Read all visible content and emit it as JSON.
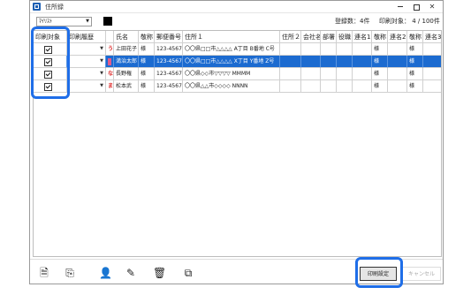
{
  "window": {
    "title": "住所録"
  },
  "header": {
    "sender_value": "ﾏｲﾘｽﾄ",
    "registered_count": "登録数：4件",
    "print_count": "印刷対象： 4 / 100件"
  },
  "grid": {
    "columns": [
      "印刷対象",
      "印刷履歴",
      "",
      "氏名",
      "敬称",
      "郵便番号",
      "住所１",
      "住所２",
      "会社名",
      "部署",
      "役職",
      "連名1",
      "敬称",
      "連名2",
      "敬称",
      "連名3"
    ],
    "rows": [
      {
        "checked": true,
        "mark": "う",
        "name": "上田花子",
        "title": "様",
        "zip": "123-4567",
        "addr1": "〇〇県□□市△△△△ A丁目 B番地 C号",
        "r1t": "様",
        "r2t": "様"
      },
      {
        "checked": true,
        "mark": "",
        "name": "満治太郎",
        "title": "様",
        "zip": "123-4567",
        "addr1": "〇〇県□□市△△△△ X丁目 Y番地 Z号",
        "r1t": "様",
        "r2t": "様"
      },
      {
        "checked": true,
        "mark": "な",
        "name": "長野権",
        "title": "様",
        "zip": "123-4567",
        "addr1": "〇〇県◇◇市▽▽▽▽ MMMM",
        "r1t": "様",
        "r2t": "様"
      },
      {
        "checked": true,
        "mark": "ま",
        "name": "松本武",
        "title": "様",
        "zip": "123-4567",
        "addr1": "〇〇県△△市◇◇◇◇ NNNN",
        "r1t": "様",
        "r2t": "様"
      }
    ]
  },
  "footer": {
    "print_settings_label": "印刷設定",
    "cancel_label": "キャンセル"
  },
  "colors": {
    "selection": "#1c6bd0",
    "highlight": "#1f6ee8"
  }
}
